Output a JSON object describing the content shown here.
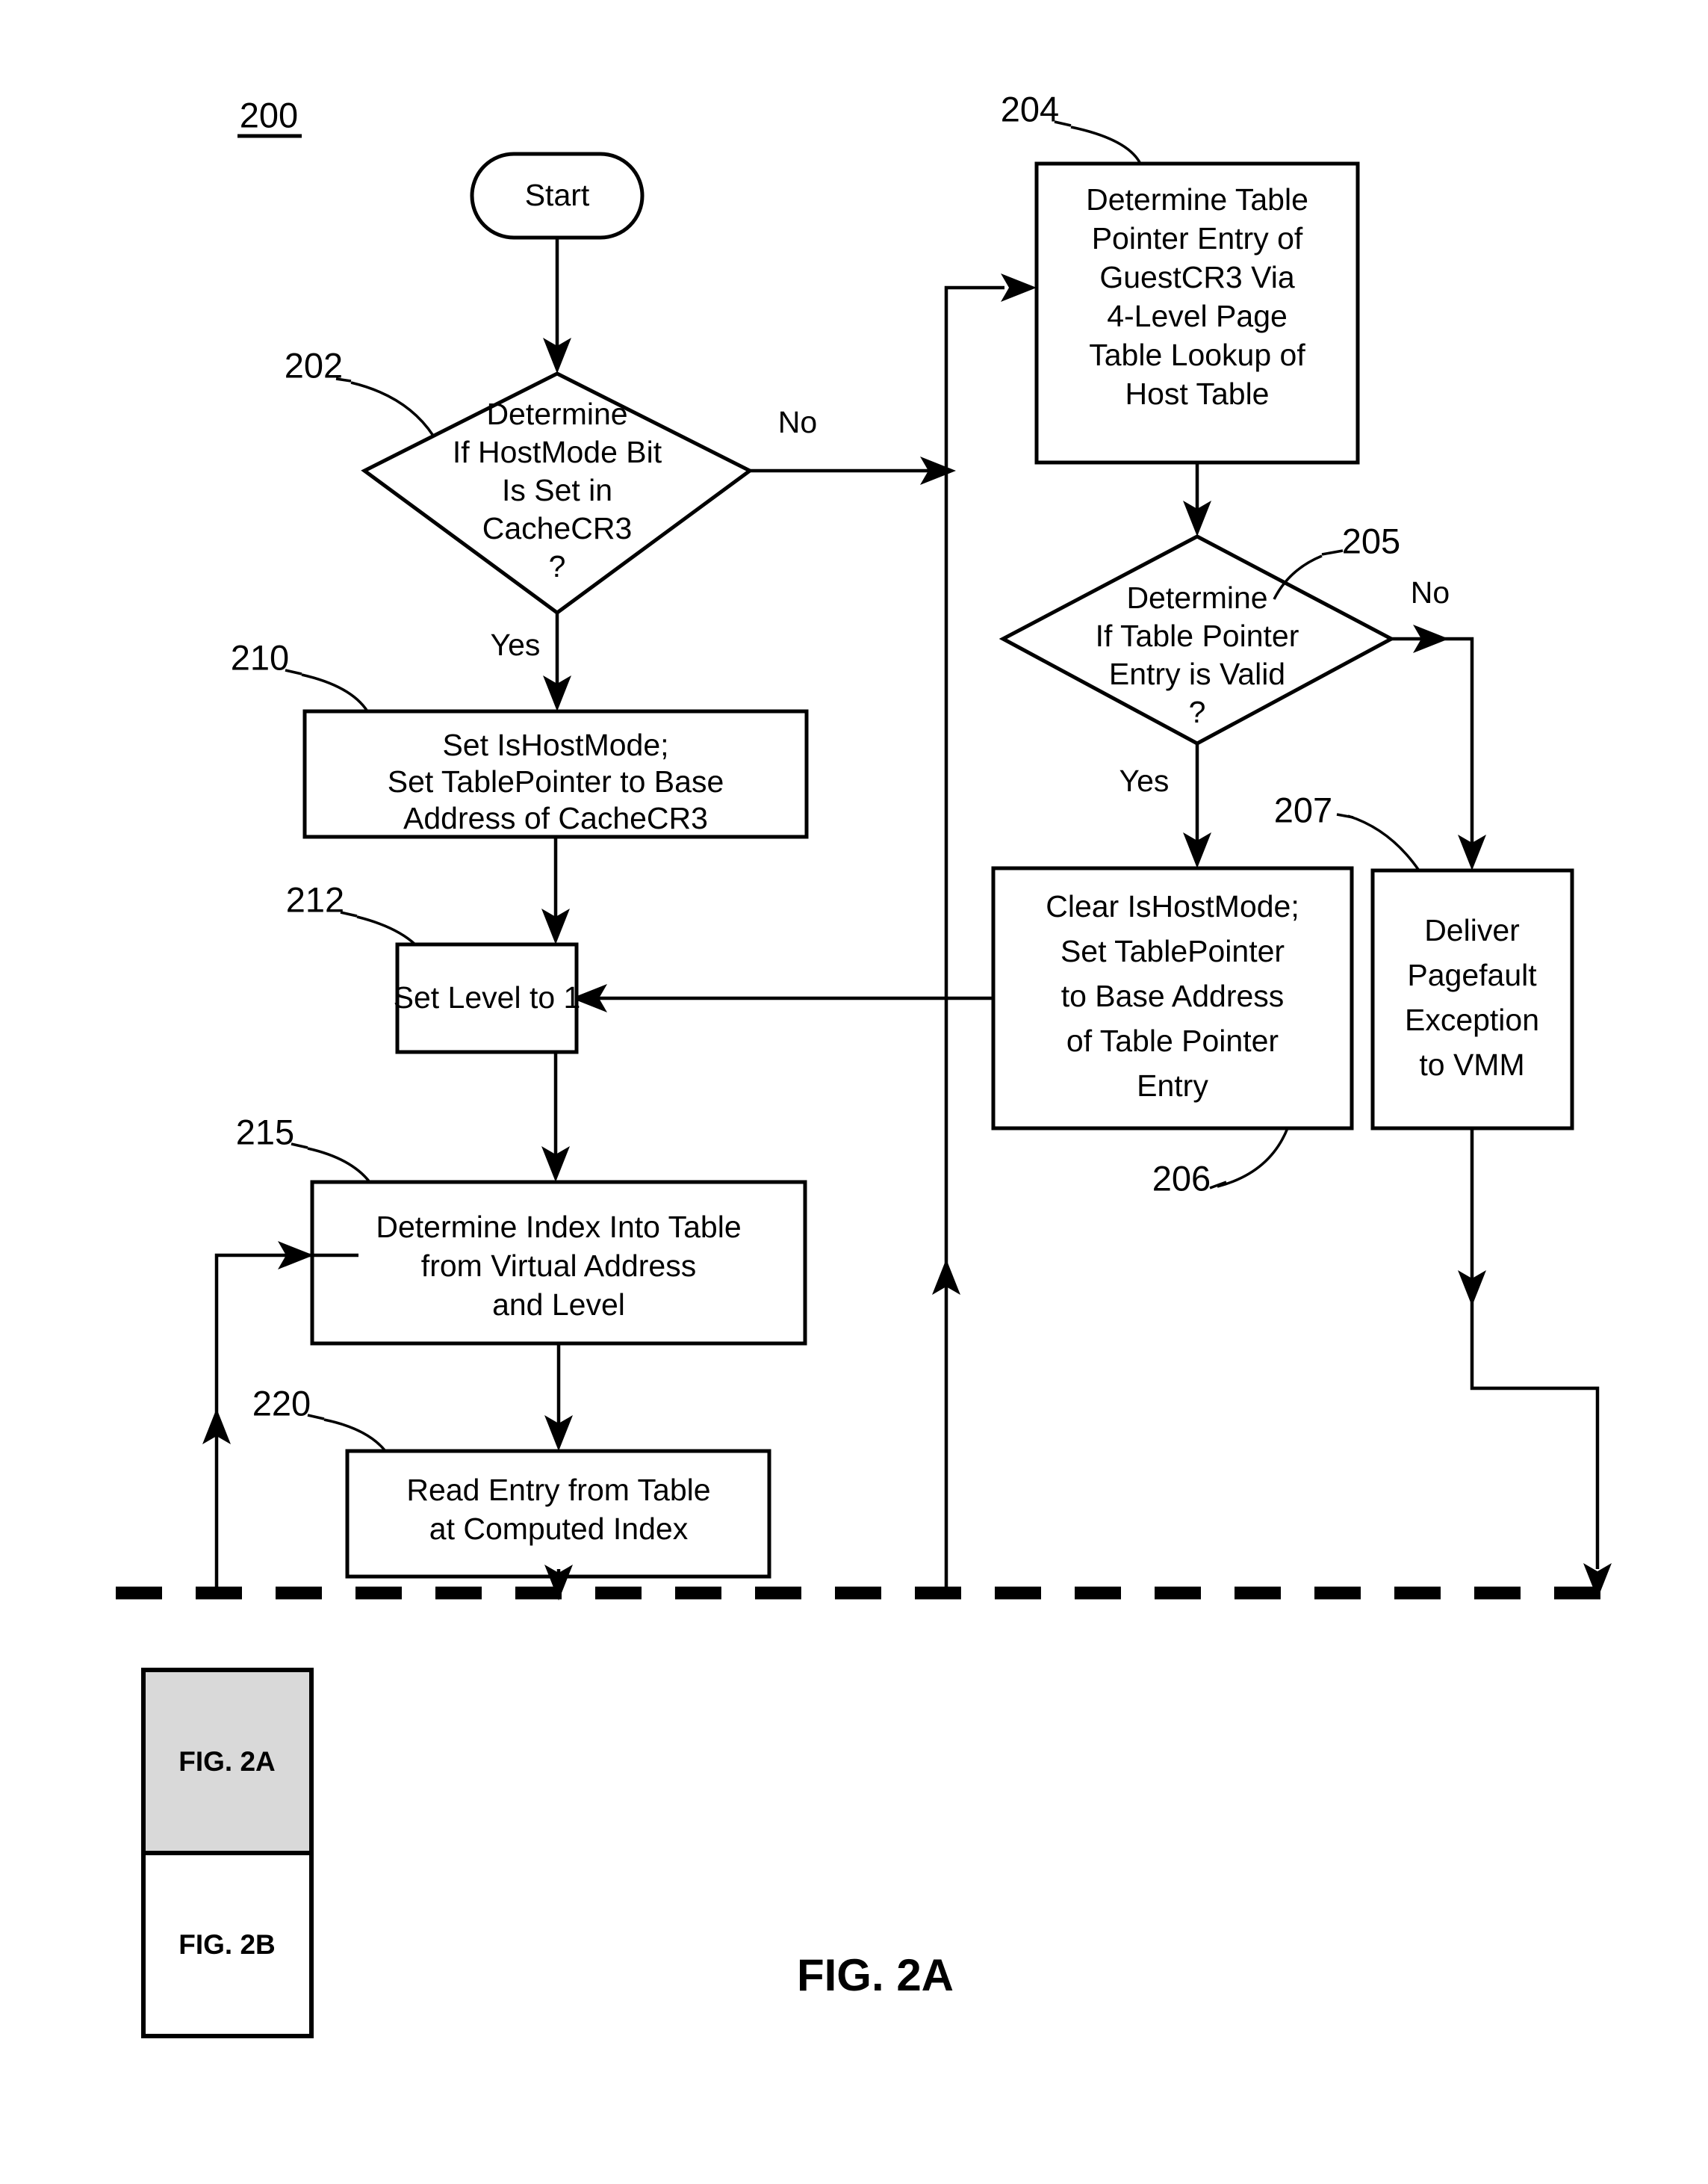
{
  "figure": {
    "diagram_ref": "200",
    "caption": "FIG. 2A",
    "sheet_key": {
      "top_label": "FIG. 2A",
      "bottom_label": "FIG. 2B"
    }
  },
  "nodes": {
    "start": {
      "ref": "",
      "label": "Start",
      "lines": [
        "Start"
      ],
      "shape": "terminator"
    },
    "decision_202": {
      "ref": "202",
      "shape": "decision",
      "lines": [
        "Determine",
        "If HostMode Bit",
        "Is Set in",
        "CacheCR3",
        "?"
      ]
    },
    "process_204": {
      "ref": "204",
      "shape": "process",
      "lines": [
        "Determine Table",
        "Pointer Entry of",
        "GuestCR3 Via",
        "4-Level Page",
        "Table Lookup of",
        "Host Table"
      ]
    },
    "decision_205": {
      "ref": "205",
      "shape": "decision",
      "lines": [
        "Determine",
        "If Table Pointer",
        "Entry is Valid",
        "?"
      ]
    },
    "process_206": {
      "ref": "206",
      "shape": "process",
      "lines": [
        "Clear IsHostMode;",
        "Set TablePointer",
        "to Base Address",
        "of Table Pointer",
        "Entry"
      ]
    },
    "process_207": {
      "ref": "207",
      "shape": "process",
      "lines": [
        "Deliver",
        "Pagefault",
        "Exception",
        "to VMM"
      ]
    },
    "process_210": {
      "ref": "210",
      "shape": "process",
      "lines": [
        "Set IsHostMode;",
        "Set TablePointer to Base",
        "Address of CacheCR3"
      ]
    },
    "process_212": {
      "ref": "212",
      "shape": "process",
      "lines": [
        "Set Level to 1"
      ]
    },
    "process_215": {
      "ref": "215",
      "shape": "process",
      "lines": [
        "Determine Index Into Table",
        "from Virtual Address",
        "and Level"
      ]
    },
    "process_220": {
      "ref": "220",
      "shape": "process",
      "lines": [
        "Read Entry from Table",
        "at Computed Index"
      ]
    }
  },
  "edge_labels": {
    "d202_no": "No",
    "d202_yes": "Yes",
    "d205_no": "No",
    "d205_yes": "Yes"
  },
  "colors": {
    "ink": "#000000",
    "paper": "#ffffff",
    "legend_shade": "#d9d9d9"
  }
}
